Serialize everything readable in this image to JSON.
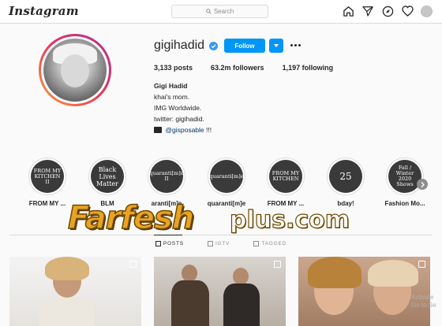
{
  "header": {
    "logo": "Instagram",
    "search_placeholder": "Search",
    "icons": [
      "home-icon",
      "direct-icon",
      "explore-icon",
      "activity-heart-icon",
      "profile-avatar"
    ]
  },
  "profile": {
    "username": "gigihadid",
    "verified": true,
    "follow_label": "Follow",
    "posts": "3,133 posts",
    "followers": "63.2m followers",
    "following": "1,197 following",
    "name": "Gigi Hadid",
    "bio_lines": [
      "khai's mom.",
      "IMG Worldwide.",
      "twitter: gigihadid."
    ],
    "bio_link": "@gisposable",
    "bio_link_suffix": " !!!"
  },
  "highlights": [
    {
      "circle_text": "FROM MY KITCHEN II",
      "label": "FROM MY ..."
    },
    {
      "circle_text": "Black Lives Matter",
      "label": "BLM"
    },
    {
      "circle_text": "quaranti[m]e II",
      "label": "aranti[m]e"
    },
    {
      "circle_text": "quaranti[m]e",
      "label": "quaranti[m]e"
    },
    {
      "circle_text": "FROM MY KITCHEN",
      "label": "FROM MY ..."
    },
    {
      "circle_text": "25",
      "label": "bday!"
    },
    {
      "circle_text": "Fall / Winter 2020 Shows",
      "label": "Fashion Mo..."
    }
  ],
  "tabs": [
    {
      "label": "POSTS",
      "active": true
    },
    {
      "label": "IGTV",
      "active": false
    },
    {
      "label": "TAGGED",
      "active": false
    }
  ],
  "watermark": {
    "main": "Farfesh",
    "sub": "plus.com"
  },
  "os_notice": [
    "Activate",
    "Go to Se"
  ],
  "colors": {
    "accent": "#0095f6",
    "text": "#262626",
    "muted": "#8e8e8e",
    "border": "#dbdbdb"
  }
}
